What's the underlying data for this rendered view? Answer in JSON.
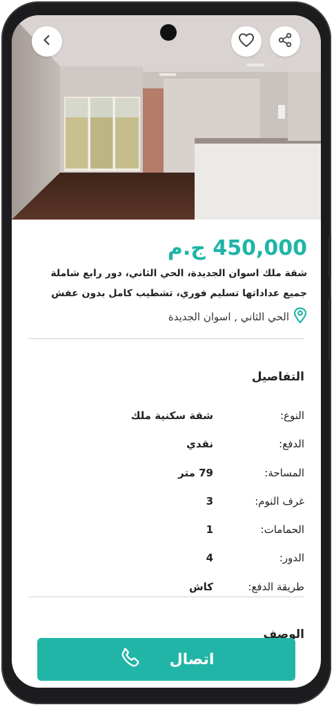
{
  "header": {
    "back_icon": "chevron-left-icon",
    "favorite_icon": "heart-icon",
    "share_icon": "share-icon"
  },
  "listing": {
    "price": "450,000 ج.م",
    "description": "شقة ملك اسوان الجديدة، الحي الثاني، دور رابع شاملة جميع عداداتها تسليم فوري، تشطيب كامل بدون عفش",
    "location": "الحي الثاني , اسوان الجديدة"
  },
  "details": {
    "title": "التفاصيل",
    "rows": [
      {
        "label": "النوع:",
        "value": "شقة سكنية ملك"
      },
      {
        "label": "الدفع:",
        "value": "نقدي"
      },
      {
        "label": "المساحة:",
        "value": "79 متر"
      },
      {
        "label": "غرف النوم:",
        "value": "3"
      },
      {
        "label": "الحمامات:",
        "value": "1"
      },
      {
        "label": "الدور:",
        "value": "4"
      },
      {
        "label": "طريقة الدفع:",
        "value": "كاش"
      }
    ]
  },
  "description_section": {
    "title": "الوصف"
  },
  "call_button": {
    "label": "اتصال",
    "icon": "phone-icon"
  },
  "colors": {
    "accent": "#21b5a7",
    "text": "#222222",
    "divider": "#d3d3d3"
  }
}
